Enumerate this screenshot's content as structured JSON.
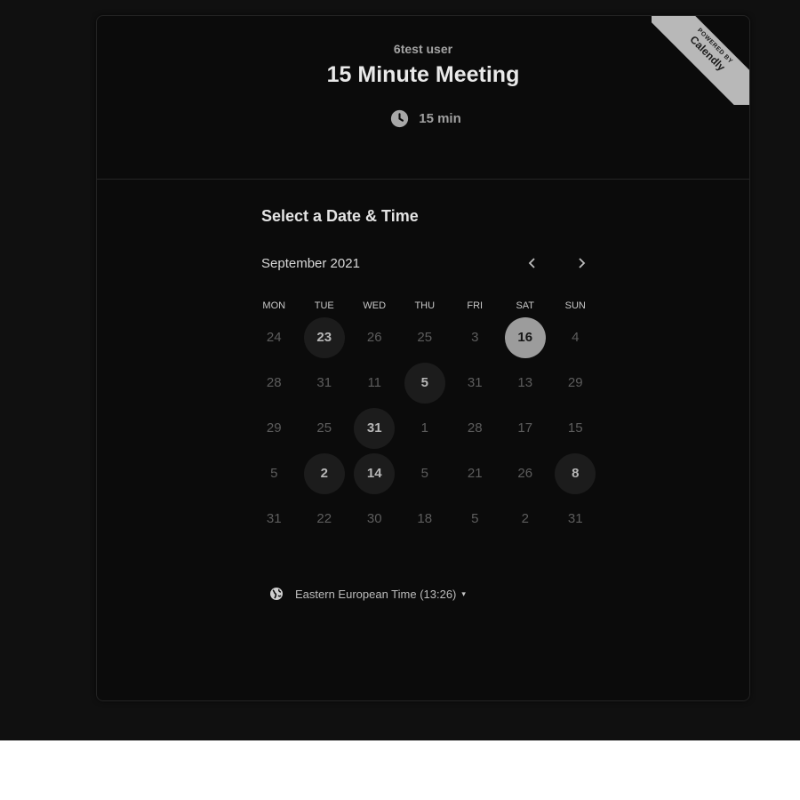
{
  "header": {
    "owner": "6test user",
    "title": "15 Minute Meeting",
    "duration": "15 min",
    "duration_icon": "clock-icon"
  },
  "ribbon": {
    "small": "POWERED BY",
    "brand": "Calendly"
  },
  "calendar": {
    "heading": "Select a Date & Time",
    "month_label": "September 2021",
    "prev_icon": "chevron-left-icon",
    "next_icon": "chevron-right-icon",
    "weekdays": [
      "MON",
      "TUE",
      "WED",
      "THU",
      "FRI",
      "SAT",
      "SUN"
    ],
    "weeks": [
      [
        {
          "d": "24",
          "s": "plain"
        },
        {
          "d": "23",
          "s": "available"
        },
        {
          "d": "26",
          "s": "plain"
        },
        {
          "d": "25",
          "s": "plain"
        },
        {
          "d": "3",
          "s": "plain"
        },
        {
          "d": "16",
          "s": "selected"
        },
        {
          "d": "4",
          "s": "plain"
        }
      ],
      [
        {
          "d": "28",
          "s": "plain"
        },
        {
          "d": "31",
          "s": "plain"
        },
        {
          "d": "11",
          "s": "plain"
        },
        {
          "d": "5",
          "s": "available"
        },
        {
          "d": "31",
          "s": "plain"
        },
        {
          "d": "13",
          "s": "plain"
        },
        {
          "d": "29",
          "s": "plain"
        }
      ],
      [
        {
          "d": "29",
          "s": "plain"
        },
        {
          "d": "25",
          "s": "plain"
        },
        {
          "d": "31",
          "s": "available"
        },
        {
          "d": "1",
          "s": "plain"
        },
        {
          "d": "28",
          "s": "plain"
        },
        {
          "d": "17",
          "s": "plain"
        },
        {
          "d": "15",
          "s": "plain"
        }
      ],
      [
        {
          "d": "5",
          "s": "plain"
        },
        {
          "d": "2",
          "s": "available"
        },
        {
          "d": "14",
          "s": "available"
        },
        {
          "d": "5",
          "s": "plain"
        },
        {
          "d": "21",
          "s": "plain"
        },
        {
          "d": "26",
          "s": "plain"
        },
        {
          "d": "8",
          "s": "available"
        }
      ],
      [
        {
          "d": "31",
          "s": "plain"
        },
        {
          "d": "22",
          "s": "plain"
        },
        {
          "d": "30",
          "s": "plain"
        },
        {
          "d": "18",
          "s": "plain"
        },
        {
          "d": "5",
          "s": "plain"
        },
        {
          "d": "2",
          "s": "plain"
        },
        {
          "d": "31",
          "s": "plain"
        }
      ]
    ]
  },
  "timezone": {
    "label": "Eastern European Time (13:26)",
    "icon": "globe-icon",
    "caret": "▾"
  },
  "colors": {
    "page_background": "#101010",
    "card_background": "#0b0b0b",
    "selected_day": "#9c9c9c",
    "available_day": "#1c1c1c"
  }
}
